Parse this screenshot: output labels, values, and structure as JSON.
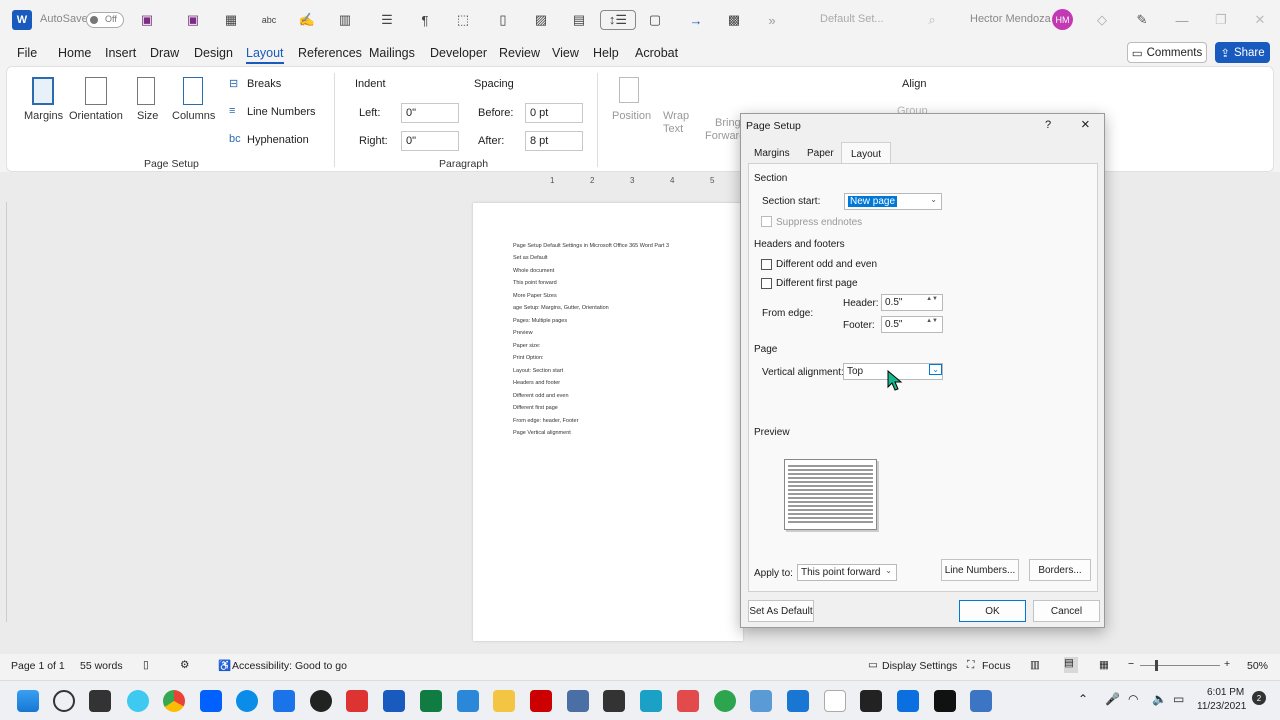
{
  "title_bar": {
    "autosave": "AutoSave",
    "toggle": "Off",
    "doc_name": "Default Set...",
    "user": "Hector Mendoza",
    "initials": "HM"
  },
  "menu": {
    "file": "File",
    "home": "Home",
    "insert": "Insert",
    "draw": "Draw",
    "design": "Design",
    "layout": "Layout",
    "references": "References",
    "mailings": "Mailings",
    "developer": "Developer",
    "review": "Review",
    "view": "View",
    "help": "Help",
    "acrobat": "Acrobat",
    "comments": "Comments",
    "share": "Share"
  },
  "ribbon": {
    "margins": "Margins",
    "orientation": "Orientation",
    "size": "Size",
    "columns": "Columns",
    "breaks": "Breaks",
    "line_numbers": "Line Numbers",
    "hyphenation": "Hyphenation",
    "page_setup": "Page Setup",
    "indent": "Indent",
    "spacing": "Spacing",
    "left": "Left:",
    "left_val": "0\"",
    "right": "Right:",
    "right_val": "0\"",
    "before": "Before:",
    "before_val": "0 pt",
    "after": "After:",
    "after_val": "8 pt",
    "paragraph": "Paragraph",
    "position": "Position",
    "wrap": "Wrap",
    "text": "Text",
    "bring": "Bring",
    "forward": "Forward",
    "align": "Align",
    "group": "Group"
  },
  "ruler": {
    "n1": "1",
    "n2": "2",
    "n3": "3",
    "n4": "4",
    "n5": "5"
  },
  "document": {
    "lines": [
      "Page Setup Default Settings in Microsoft Office 365 Word Part 3",
      "Set as Default",
      "Whole document",
      "This point forward",
      "More Paper Sizes",
      "age Setup: Margins, Gutter, Orientation",
      "Pages:  Multiple pages",
      "Preview",
      "Paper size:",
      "Print Option:",
      "Layout:  Section start",
      "Headers and footer",
      "Different odd and even",
      "Different first page",
      "From edge:  header, Footer",
      "Page Vertical alignment"
    ]
  },
  "dialog": {
    "title": "Page Setup",
    "help": "?",
    "close": "×",
    "tabs": [
      "Margins",
      "Paper",
      "Layout"
    ],
    "section": "Section",
    "section_start": "Section start:",
    "section_start_val": "New page",
    "suppress": "Suppress endnotes",
    "headers_footers": "Headers and footers",
    "odd_even": "Different odd and even",
    "first_page": "Different first page",
    "from_edge": "From edge:",
    "header": "Header:",
    "header_val": "0.5\"",
    "footer": "Footer:",
    "footer_val": "0.5\"",
    "page": "Page",
    "valign": "Vertical alignment:",
    "valign_val": "Top",
    "preview": "Preview",
    "apply_to": "Apply to:",
    "apply_val": "This point forward",
    "line_numbers": "Line Numbers...",
    "borders": "Borders...",
    "set_default": "Set As Default",
    "ok": "OK",
    "cancel": "Cancel"
  },
  "status": {
    "page": "Page 1 of 1",
    "words": "55 words",
    "accessibility": "Accessibility: Good to go",
    "display": "Display Settings",
    "focus": "Focus",
    "zoom": "50%"
  },
  "taskbar": {
    "time": "6:01 PM",
    "date": "11/23/2021",
    "badge": "2"
  }
}
